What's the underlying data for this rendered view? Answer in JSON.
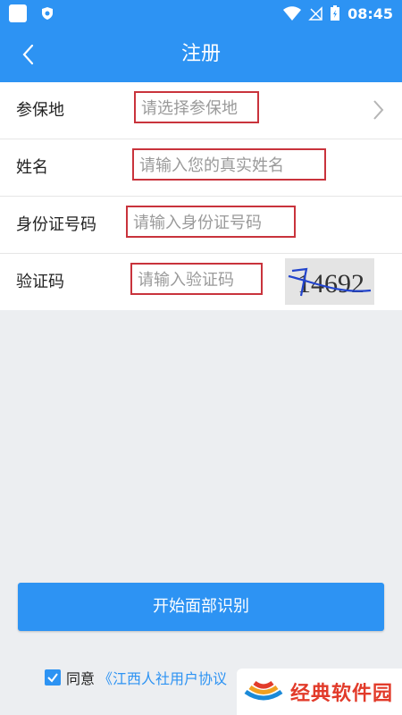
{
  "status_bar": {
    "time": "08:45"
  },
  "header": {
    "title": "注册"
  },
  "form": {
    "rows": [
      {
        "label": "参保地",
        "placeholder": "请选择参保地"
      },
      {
        "label": "姓名",
        "placeholder": "请输入您的真实姓名"
      },
      {
        "label": "身份证号码",
        "placeholder": "请输入身份证号码"
      },
      {
        "label": "验证码",
        "placeholder": "请输入验证码",
        "captcha_text": "14692"
      }
    ]
  },
  "actions": {
    "start_label": "开始面部识别"
  },
  "agreement": {
    "prefix": "同意",
    "link": "《江西人社用户协议"
  },
  "watermark": {
    "text": "经典软件园"
  },
  "colors": {
    "primary": "#2d93f3",
    "highlight_border": "#c9333c",
    "watermark": "#e23b2a"
  }
}
